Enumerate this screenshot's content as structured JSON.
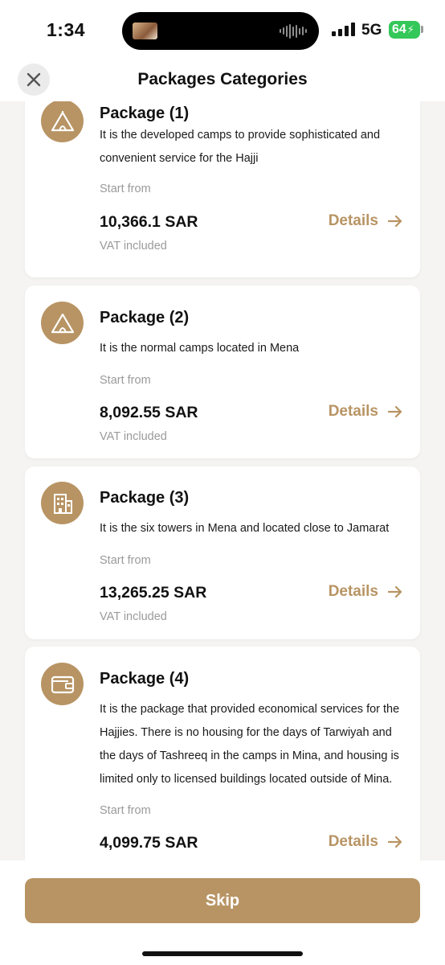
{
  "status_bar": {
    "time": "1:34",
    "network": "5G",
    "battery": "64"
  },
  "header": {
    "title": "Packages Categories"
  },
  "packages": [
    {
      "title": "Package (1)",
      "description": "It is the developed camps to provide sophisticated and convenient service for the Hajji",
      "start_label": "Start from",
      "price": "10,366.1 SAR",
      "vat": "VAT included",
      "details_label": "Details",
      "icon": "tent-icon"
    },
    {
      "title": "Package (2)",
      "description": "It is the normal camps located in Mena",
      "start_label": "Start from",
      "price": "8,092.55 SAR",
      "vat": "VAT included",
      "details_label": "Details",
      "icon": "tent-icon"
    },
    {
      "title": "Package (3)",
      "description": "It is the six towers in Mena and located close to Jamarat",
      "start_label": "Start from",
      "price": "13,265.25 SAR",
      "vat": "VAT included",
      "details_label": "Details",
      "icon": "building-icon"
    },
    {
      "title": "Package (4)",
      "description": "It is the package that provided economical services for the Hajjies. There is no housing for the days of Tarwiyah and the days of Tashreeq in the camps in Mina, and housing is limited only to licensed buildings located outside of Mina.",
      "start_label": "Start from",
      "price": "4,099.75 SAR",
      "details_label": "Details",
      "icon": "wallet-icon"
    }
  ],
  "footer": {
    "skip_label": "Skip"
  },
  "colors": {
    "accent": "#b89464",
    "battery": "#34c759"
  }
}
